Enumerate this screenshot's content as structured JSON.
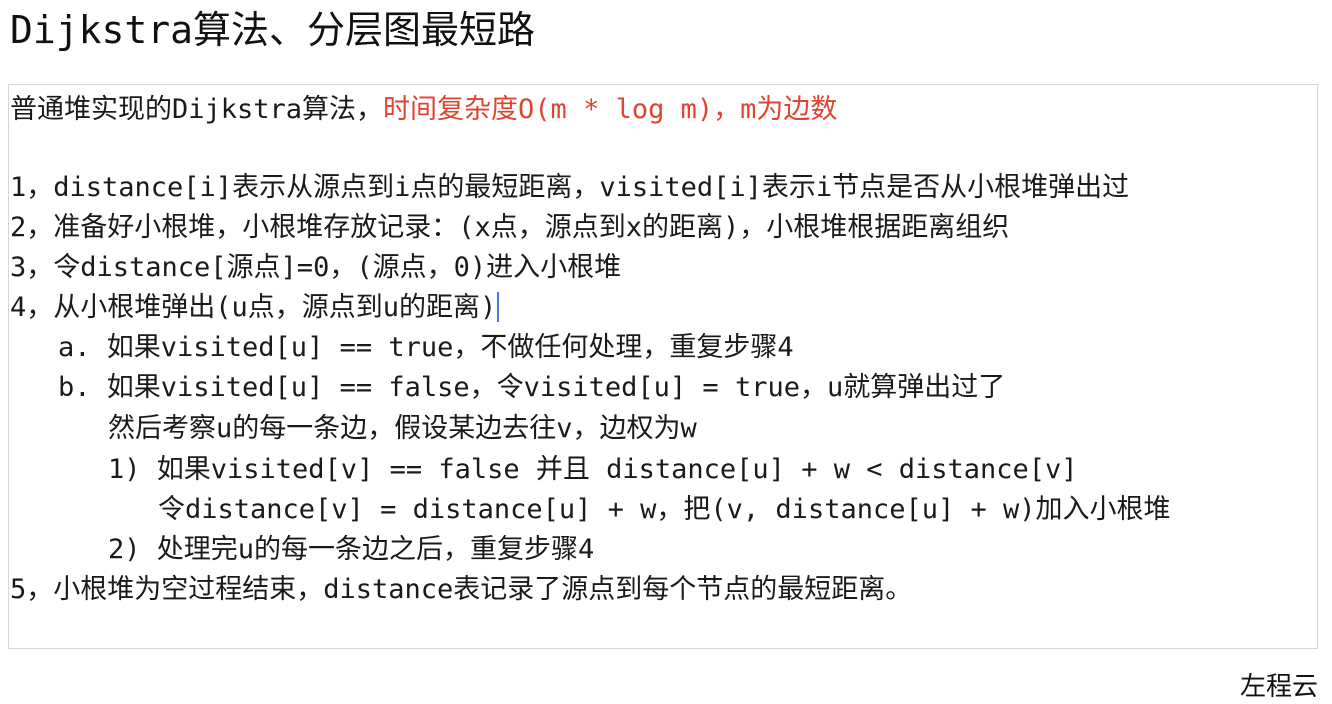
{
  "title": "Dijkstra算法、分层图最短路",
  "intro": {
    "prefix": "普通堆实现的Dijkstra算法，",
    "highlight": "时间复杂度O(m * log m)，m为边数"
  },
  "steps": [
    "1，distance[i]表示从源点到i点的最短距离，visited[i]表示i节点是否从小根堆弹出过",
    "2，准备好小根堆，小根堆存放记录：(x点，源点到x的距离)，小根堆根据距离组织",
    "3，令distance[源点]=0，(源点，0)进入小根堆",
    "4，从小根堆弹出(u点，源点到u的距离)",
    "a. 如果visited[u] == true，不做任何处理，重复步骤4",
    "b. 如果visited[u] == false，令visited[u] = true，u就算弹出过了",
    "然后考察u的每一条边，假设某边去往v，边权为w",
    "1) 如果visited[v] == false 并且 distance[u] + w < distance[v]",
    "令distance[v] = distance[u] + w，把(v, distance[u] + w)加入小根堆",
    "2) 处理完u的每一条边之后，重复步骤4",
    "5，小根堆为空过程结束，distance表记录了源点到每个节点的最短距离。"
  ],
  "author": "左程云"
}
